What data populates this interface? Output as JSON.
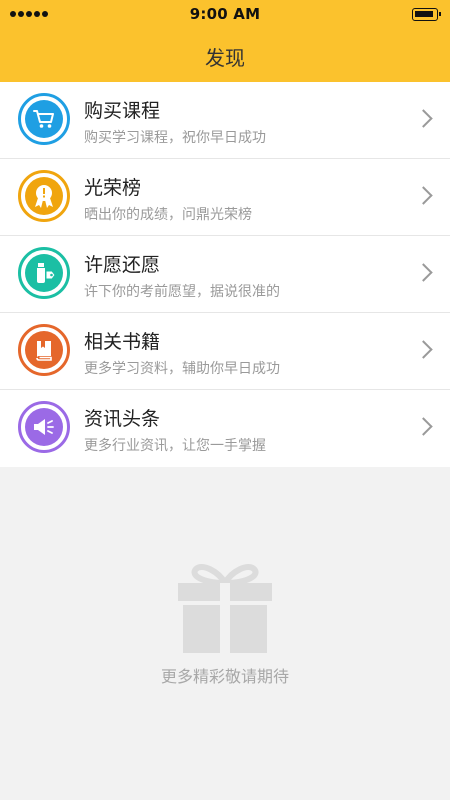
{
  "status_bar": {
    "time": "9:00 AM"
  },
  "header": {
    "title": "发现"
  },
  "items": [
    {
      "title": "购买课程",
      "subtitle": "购买学习课程，祝你早日成功",
      "icon": "cart-icon",
      "color": "#1f9fe3"
    },
    {
      "title": "光荣榜",
      "subtitle": "晒出你的成绩，问鼎光荣榜",
      "icon": "medal-icon",
      "color": "#f0a50e"
    },
    {
      "title": "许愿还愿",
      "subtitle": "许下你的考前愿望，据说很准的",
      "icon": "wish-bottle-icon",
      "color": "#1bbfa4"
    },
    {
      "title": "相关书籍",
      "subtitle": "更多学习资料，辅助你早日成功",
      "icon": "book-icon",
      "color": "#e5672b"
    },
    {
      "title": "资讯头条",
      "subtitle": "更多行业资讯，让您一手掌握",
      "icon": "megaphone-icon",
      "color": "#9b6ae6"
    }
  ],
  "empty_state": {
    "text": "更多精彩敬请期待",
    "icon": "gift-icon"
  }
}
